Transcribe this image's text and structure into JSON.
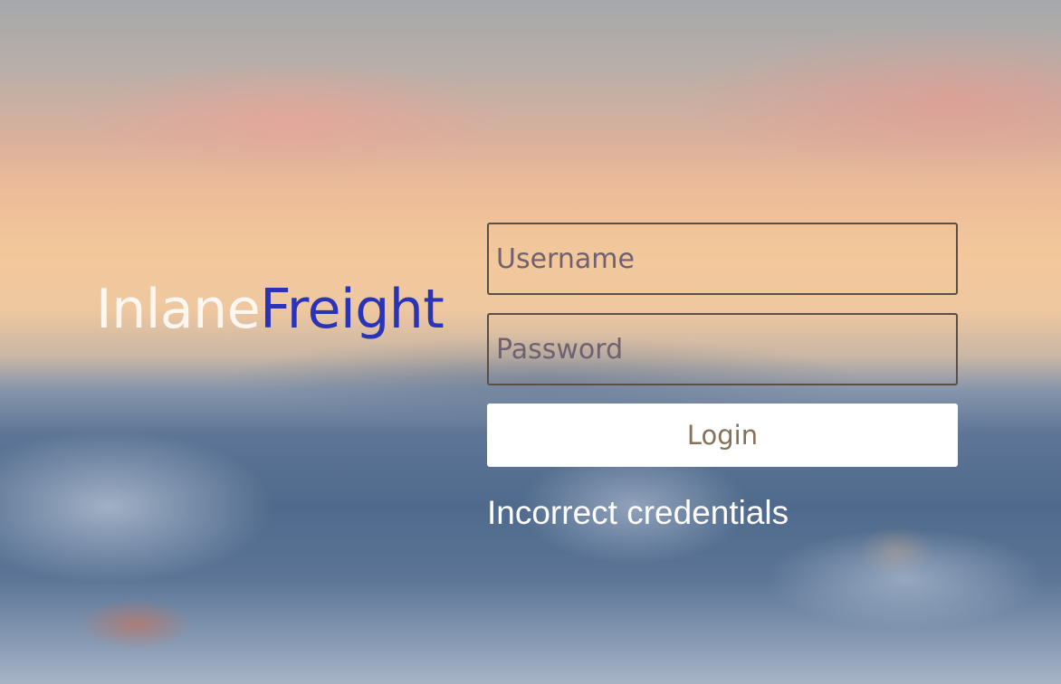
{
  "brand": {
    "part1": "Inlane",
    "part2": "Freight"
  },
  "form": {
    "username_placeholder": "Username",
    "username_value": "",
    "password_placeholder": "Password",
    "password_value": "",
    "login_label": "Login",
    "error_message": "Incorrect credentials"
  },
  "colors": {
    "brand_part1": "#ffffff",
    "brand_part2": "#2a34b8",
    "input_border": "#5a4f47",
    "button_bg": "#ffffff",
    "button_text": "#857158",
    "error_text": "#ffffff"
  }
}
